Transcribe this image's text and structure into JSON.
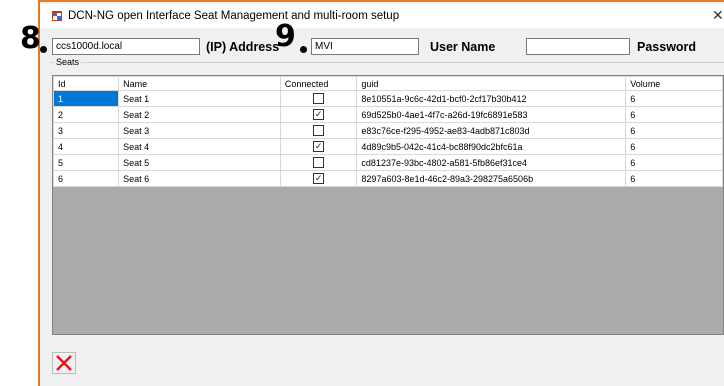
{
  "window": {
    "title": "DCN-NG open Interface Seat Management and multi-room setup",
    "close_glyph": "✕"
  },
  "callouts": {
    "c8": "8",
    "c9": "9"
  },
  "connection": {
    "address_value": "ccs1000d.local",
    "address_label": "(IP) Address",
    "username_value": "MVI",
    "username_label": "User Name",
    "password_value": "",
    "password_label": "Password"
  },
  "seats": {
    "group_label": "Seats",
    "columns": [
      "Id",
      "Name",
      "Connected",
      "guid",
      "Volume"
    ],
    "rows": [
      {
        "id": "1",
        "name": "Seat 1",
        "connected": false,
        "guid": "8e10551a-9c6c-42d1-bcf0-2cf17b30b412",
        "volume": "6"
      },
      {
        "id": "2",
        "name": "Seat 2",
        "connected": true,
        "guid": "69d525b0-4ae1-4f7c-a26d-19fc6891e583",
        "volume": "6"
      },
      {
        "id": "3",
        "name": "Seat 3",
        "connected": false,
        "guid": "e83c76ce-f295-4952-ae83-4adb871c803d",
        "volume": "6"
      },
      {
        "id": "4",
        "name": "Seat 4",
        "connected": true,
        "guid": "4d89c9b5-042c-41c4-bc88f90dc2bfc61a",
        "volume": "6"
      },
      {
        "id": "5",
        "name": "Seat 5",
        "connected": false,
        "guid": "cd81237e-93bc-4802-a581-5fb86ef31ce4",
        "volume": "6"
      },
      {
        "id": "6",
        "name": "Seat 6",
        "connected": true,
        "guid": "8297a603-8e1d-46c2-89a3-298275a6506b",
        "volume": "6"
      }
    ]
  },
  "icons": {
    "app": "app-window-icon",
    "cancel": "red-x-icon"
  },
  "colors": {
    "accent_border": "#e07b28",
    "selection": "#0078d7",
    "cancel_red": "#e81123"
  }
}
